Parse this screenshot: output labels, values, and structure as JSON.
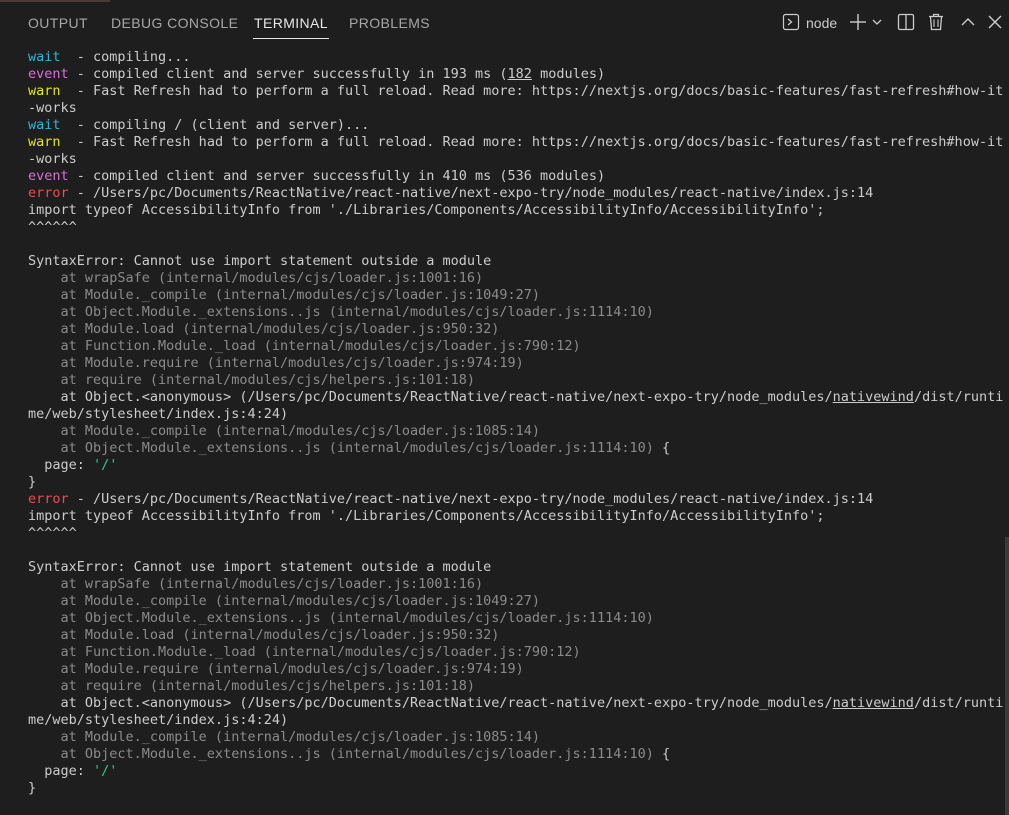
{
  "tabs": [
    {
      "label": "OUTPUT"
    },
    {
      "label": "DEBUG CONSOLE"
    },
    {
      "label": "TERMINAL"
    },
    {
      "label": "PROBLEMS"
    }
  ],
  "active_tab": "TERMINAL",
  "toolbar": {
    "terminal_name": "node",
    "icons": [
      "terminal-icon",
      "plus-icon",
      "chevron-down-icon",
      "split-terminal-icon",
      "trash-icon",
      "chevron-up-icon",
      "close-icon"
    ]
  },
  "colors": {
    "background": "#1e1e1e",
    "wait": "#29b8db",
    "event": "#d670d6",
    "warn": "#e5e510",
    "error": "#f14c4c",
    "string": "#23d18b",
    "stack_dim": "#8b8b8b"
  },
  "terminal": {
    "lines": [
      {
        "parts": [
          {
            "t": "wait",
            "c": "wait"
          },
          {
            "t": "  - compiling...",
            "c": ""
          }
        ]
      },
      {
        "parts": [
          {
            "t": "event",
            "c": "event"
          },
          {
            "t": " - compiled client and server successfully in 193 ms (",
            "c": ""
          },
          {
            "t": "182",
            "c": "u"
          },
          {
            "t": " modules)",
            "c": ""
          }
        ]
      },
      {
        "parts": [
          {
            "t": "warn",
            "c": "warn"
          },
          {
            "t": "  - Fast Refresh had to perform a full reload. Read more: https://nextjs.org/docs/basic-features/fast-refresh#how-it",
            "c": ""
          }
        ]
      },
      {
        "parts": [
          {
            "t": "-works",
            "c": ""
          }
        ]
      },
      {
        "parts": [
          {
            "t": "wait",
            "c": "wait"
          },
          {
            "t": "  - compiling / (client and server)...",
            "c": ""
          }
        ]
      },
      {
        "parts": [
          {
            "t": "warn",
            "c": "warn"
          },
          {
            "t": "  - Fast Refresh had to perform a full reload. Read more: https://nextjs.org/docs/basic-features/fast-refresh#how-it",
            "c": ""
          }
        ]
      },
      {
        "parts": [
          {
            "t": "-works",
            "c": ""
          }
        ]
      },
      {
        "parts": [
          {
            "t": "event",
            "c": "event"
          },
          {
            "t": " - compiled client and server successfully in 410 ms (536 modules)",
            "c": ""
          }
        ]
      },
      {
        "parts": [
          {
            "t": "error",
            "c": "error"
          },
          {
            "t": " - /Users/pc/Documents/ReactNative/react-native/next-expo-try/node_modules/react-native/index.js:14",
            "c": ""
          }
        ]
      },
      {
        "parts": [
          {
            "t": "import typeof AccessibilityInfo from './Libraries/Components/AccessibilityInfo/AccessibilityInfo';",
            "c": ""
          }
        ]
      },
      {
        "parts": [
          {
            "t": "^^^^^^",
            "c": ""
          }
        ]
      },
      {
        "parts": [
          {
            "t": "",
            "c": ""
          }
        ]
      },
      {
        "parts": [
          {
            "t": "SyntaxError: Cannot use import statement outside a module",
            "c": ""
          }
        ]
      },
      {
        "parts": [
          {
            "t": "    at wrapSafe (internal/modules/cjs/loader.js:1001:16)",
            "c": "dim"
          }
        ]
      },
      {
        "parts": [
          {
            "t": "    at Module._compile (internal/modules/cjs/loader.js:1049:27)",
            "c": "dim"
          }
        ]
      },
      {
        "parts": [
          {
            "t": "    at Object.Module._extensions..js (internal/modules/cjs/loader.js:1114:10)",
            "c": "dim"
          }
        ]
      },
      {
        "parts": [
          {
            "t": "    at Module.load (internal/modules/cjs/loader.js:950:32)",
            "c": "dim"
          }
        ]
      },
      {
        "parts": [
          {
            "t": "    at Function.Module._load (internal/modules/cjs/loader.js:790:12)",
            "c": "dim"
          }
        ]
      },
      {
        "parts": [
          {
            "t": "    at Module.require (internal/modules/cjs/loader.js:974:19)",
            "c": "dim"
          }
        ]
      },
      {
        "parts": [
          {
            "t": "    at require (internal/modules/cjs/helpers.js:101:18)",
            "c": "dim"
          }
        ]
      },
      {
        "parts": [
          {
            "t": "    at Object.<anonymous> (/Users/pc/Documents/ReactNative/react-native/next-expo-try/node_modules/",
            "c": ""
          },
          {
            "t": "nativewind",
            "c": "u"
          },
          {
            "t": "/dist/runti",
            "c": ""
          }
        ]
      },
      {
        "parts": [
          {
            "t": "me/web/stylesheet/index.js:4:24)",
            "c": ""
          }
        ]
      },
      {
        "parts": [
          {
            "t": "    at Module._compile (internal/modules/cjs/loader.js:1085:14)",
            "c": "dim"
          }
        ]
      },
      {
        "parts": [
          {
            "t": "    at Object.Module._extensions..js (internal/modules/cjs/loader.js:1114:10)",
            "c": "dim"
          },
          {
            "t": " {",
            "c": ""
          }
        ]
      },
      {
        "parts": [
          {
            "t": "  page: ",
            "c": ""
          },
          {
            "t": "'/'",
            "c": "str"
          }
        ]
      },
      {
        "parts": [
          {
            "t": "}",
            "c": ""
          }
        ]
      },
      {
        "parts": [
          {
            "t": "error",
            "c": "error"
          },
          {
            "t": " - /Users/pc/Documents/ReactNative/react-native/next-expo-try/node_modules/react-native/index.js:14",
            "c": ""
          }
        ]
      },
      {
        "parts": [
          {
            "t": "import typeof AccessibilityInfo from './Libraries/Components/AccessibilityInfo/AccessibilityInfo';",
            "c": ""
          }
        ]
      },
      {
        "parts": [
          {
            "t": "^^^^^^",
            "c": ""
          }
        ]
      },
      {
        "parts": [
          {
            "t": "",
            "c": ""
          }
        ]
      },
      {
        "parts": [
          {
            "t": "SyntaxError: Cannot use import statement outside a module",
            "c": ""
          }
        ]
      },
      {
        "parts": [
          {
            "t": "    at wrapSafe (internal/modules/cjs/loader.js:1001:16)",
            "c": "dim"
          }
        ]
      },
      {
        "parts": [
          {
            "t": "    at Module._compile (internal/modules/cjs/loader.js:1049:27)",
            "c": "dim"
          }
        ]
      },
      {
        "parts": [
          {
            "t": "    at Object.Module._extensions..js (internal/modules/cjs/loader.js:1114:10)",
            "c": "dim"
          }
        ]
      },
      {
        "parts": [
          {
            "t": "    at Module.load (internal/modules/cjs/loader.js:950:32)",
            "c": "dim"
          }
        ]
      },
      {
        "parts": [
          {
            "t": "    at Function.Module._load (internal/modules/cjs/loader.js:790:12)",
            "c": "dim"
          }
        ]
      },
      {
        "parts": [
          {
            "t": "    at Module.require (internal/modules/cjs/loader.js:974:19)",
            "c": "dim"
          }
        ]
      },
      {
        "parts": [
          {
            "t": "    at require (internal/modules/cjs/helpers.js:101:18)",
            "c": "dim"
          }
        ]
      },
      {
        "parts": [
          {
            "t": "    at Object.<anonymous> (/Users/pc/Documents/ReactNative/react-native/next-expo-try/node_modules/",
            "c": ""
          },
          {
            "t": "nativewind",
            "c": "u"
          },
          {
            "t": "/dist/runti",
            "c": ""
          }
        ]
      },
      {
        "parts": [
          {
            "t": "me/web/stylesheet/index.js:4:24)",
            "c": ""
          }
        ]
      },
      {
        "parts": [
          {
            "t": "    at Module._compile (internal/modules/cjs/loader.js:1085:14)",
            "c": "dim"
          }
        ]
      },
      {
        "parts": [
          {
            "t": "    at Object.Module._extensions..js (internal/modules/cjs/loader.js:1114:10)",
            "c": "dim"
          },
          {
            "t": " {",
            "c": ""
          }
        ]
      },
      {
        "parts": [
          {
            "t": "  page: ",
            "c": ""
          },
          {
            "t": "'/'",
            "c": "str"
          }
        ]
      },
      {
        "parts": [
          {
            "t": "}",
            "c": ""
          }
        ]
      }
    ]
  }
}
